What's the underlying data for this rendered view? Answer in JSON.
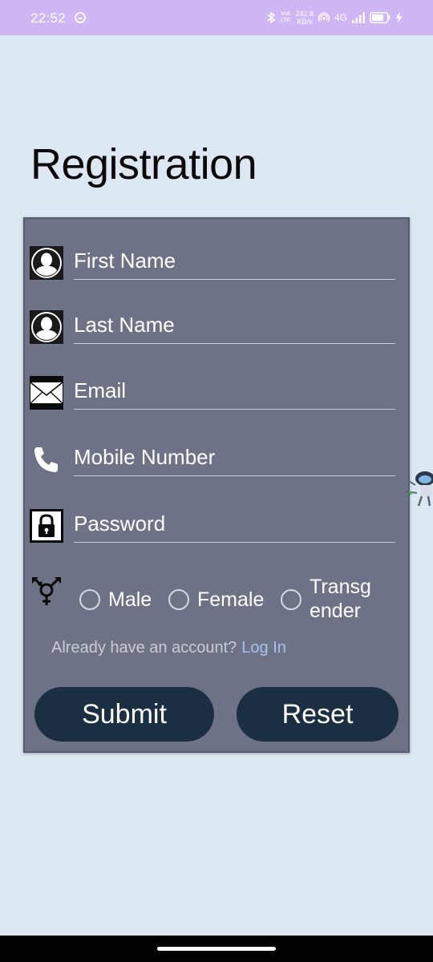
{
  "status_bar": {
    "time": "22:52",
    "network_top": "242.8",
    "network_bottom": "KB/s",
    "lte_top": "Vo8",
    "lte_bottom": "LTE",
    "cell_type": "4G"
  },
  "page": {
    "title": "Registration"
  },
  "form": {
    "fields": [
      {
        "placeholder": "First Name",
        "icon": "user-icon"
      },
      {
        "placeholder": "Last Name",
        "icon": "user-icon"
      },
      {
        "placeholder": "Email",
        "icon": "mail-icon"
      },
      {
        "placeholder": "Mobile Number",
        "icon": "phone-icon"
      },
      {
        "placeholder": "Password",
        "icon": "lock-icon"
      }
    ],
    "gender": {
      "icon": "gender-icon",
      "options": [
        "Male",
        "Female",
        "Transg\nender"
      ]
    },
    "login_prompt": "Already have an account?",
    "login_link": "Log In",
    "submit_label": "Submit",
    "reset_label": "Reset"
  },
  "colors": {
    "status_bar": "#cfb6f5",
    "background": "#dde7f1",
    "card": "#6e7286",
    "button": "#1b2f43",
    "link": "#a7c3ee"
  }
}
